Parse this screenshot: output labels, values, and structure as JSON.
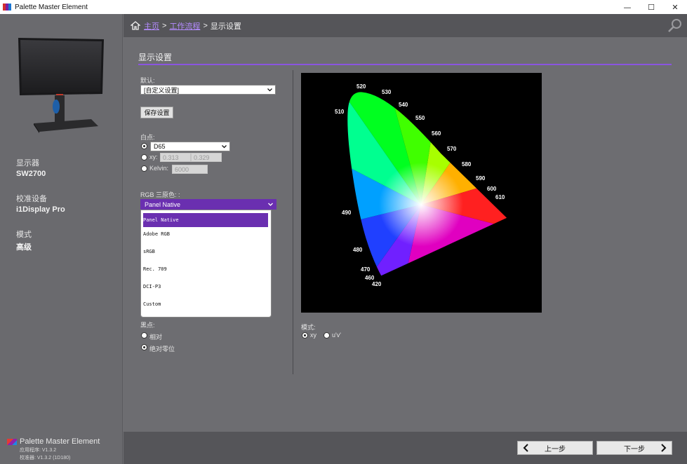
{
  "window": {
    "title": "Palette Master Element",
    "minimize": "—",
    "maximize": "☐",
    "close": "✕"
  },
  "sidebar": {
    "display_label": "显示器",
    "display_value": "SW2700",
    "device_label": "校准设备",
    "device_value": "i1Display Pro",
    "mode_label": "模式",
    "mode_value": "高级",
    "brand_name": "Palette Master Element",
    "app_version": "应用程序:   V1.3.2",
    "fw_version": "校准器:   V1.3.2 (1D180)"
  },
  "breadcrumb": {
    "home": "主页",
    "workflow": "工作流程",
    "sep": ">",
    "current": "显示设置"
  },
  "main": {
    "title": "显示设置",
    "default_label": "默认:",
    "default_value": "[自定义设置]",
    "save_button": "保存设置",
    "white_point_label": "白点:",
    "wp_options": {
      "preset": "D65",
      "xy_label": "xy:",
      "x_value": "0.313",
      "y_value": "0.329",
      "kelvin_label": "Kelvin:",
      "kelvin_value": "6000"
    },
    "primaries_label": "RGB 三原色: :",
    "primaries_value": "Panel Native",
    "primaries_options": [
      "Panel Native",
      "Adobe RGB",
      "sRGB",
      "Rec. 709",
      "DCI-P3",
      "Custom"
    ],
    "black_point_label": "黑点:",
    "black_options": [
      "相对",
      "绝对零位"
    ],
    "chart_mode_label": "模式:",
    "chart_mode_options": [
      "xy",
      "u'v'"
    ]
  },
  "cie": {
    "wavelength_labels": [
      "520",
      "530",
      "540",
      "550",
      "560",
      "570",
      "580",
      "590",
      "600",
      "610",
      "510",
      "490",
      "480",
      "470",
      "460",
      "420"
    ]
  },
  "footer": {
    "back_button": "上一步",
    "next_button": "下一步"
  },
  "colors": {
    "accent": "#6a2fb0",
    "link": "#b48cff",
    "title_line": "#8a55e0"
  }
}
